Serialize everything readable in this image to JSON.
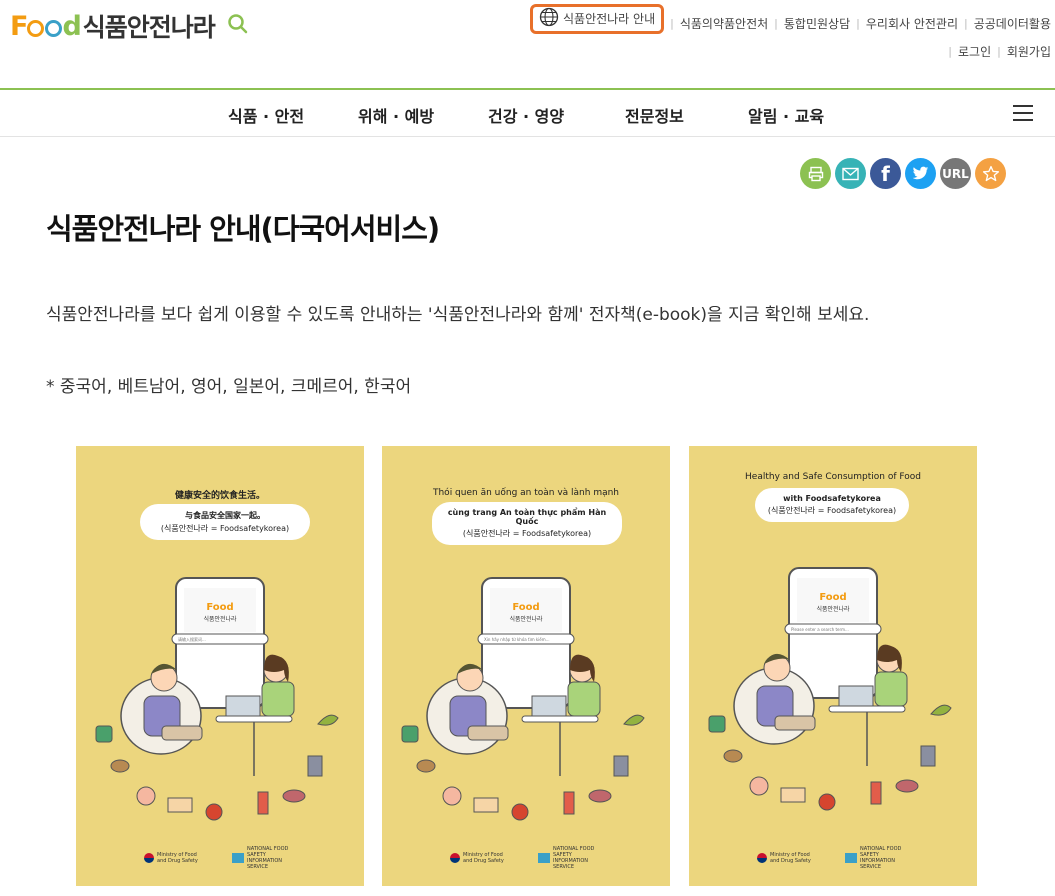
{
  "logo": {
    "food": "Food",
    "name": "식품안전나라"
  },
  "util": {
    "top": [
      "식품안전나라 안내",
      "식품의약품안전처",
      "통합민원상담",
      "우리회사 안전관리",
      "공공데이터활용"
    ],
    "bottom": [
      "로그인",
      "회원가입"
    ]
  },
  "gnb": [
    "식품 · 안전",
    "위해 · 예방",
    "건강 · 영양",
    "전문정보",
    "알림 · 교육"
  ],
  "share": {
    "url_label": "URL"
  },
  "page": {
    "title": "식품안전나라 안내(다국어서비스)",
    "description": "식품안전나라를 보다 쉽게 이용할 수 있도록 안내하는 '식품안전나라와 함께' 전자책(e-book)을 지금 확인해 보세요.",
    "languages": "* 중국어, 베트남어, 영어, 일본어, 크메르어, 한국어"
  },
  "books": [
    {
      "line1": "健康安全的饮食生活。",
      "line2": "与食品安全国家一起。",
      "line3": "(식품안전나라 = Foodsafetykorea)",
      "search": "请输入搜索词...",
      "ministry": "Ministry of Food and Drug Safety",
      "nfsis": "NATIONAL FOOD SAFETY INFORMATION SERVICE"
    },
    {
      "line1": "Thói quen ăn uống an toàn và lành mạnh",
      "line2": "cùng trang An toàn thực phẩm Hàn Quốc",
      "line3": "(식품안전나라 = Foodsafetykorea)",
      "search": "Xin hãy nhập từ khóa tìm kiếm...",
      "ministry": "Ministry of Food and Drug Safety",
      "nfsis": "NATIONAL FOOD SAFETY INFORMATION SERVICE"
    },
    {
      "line1": "Healthy and Safe Consumption of Food",
      "line2": "with Foodsafetykorea",
      "line3": "(식품안전나라 = Foodsafetykorea)",
      "search": "Please enter a search term...",
      "ministry": "Ministry of Food and Drug Safety",
      "nfsis": "NATIONAL FOOD SAFETY INFORMATION SERVICE"
    }
  ],
  "colors": {
    "accent": "#8cc152",
    "highlight": "#e8702a",
    "book_bg": "#ecd67e"
  }
}
